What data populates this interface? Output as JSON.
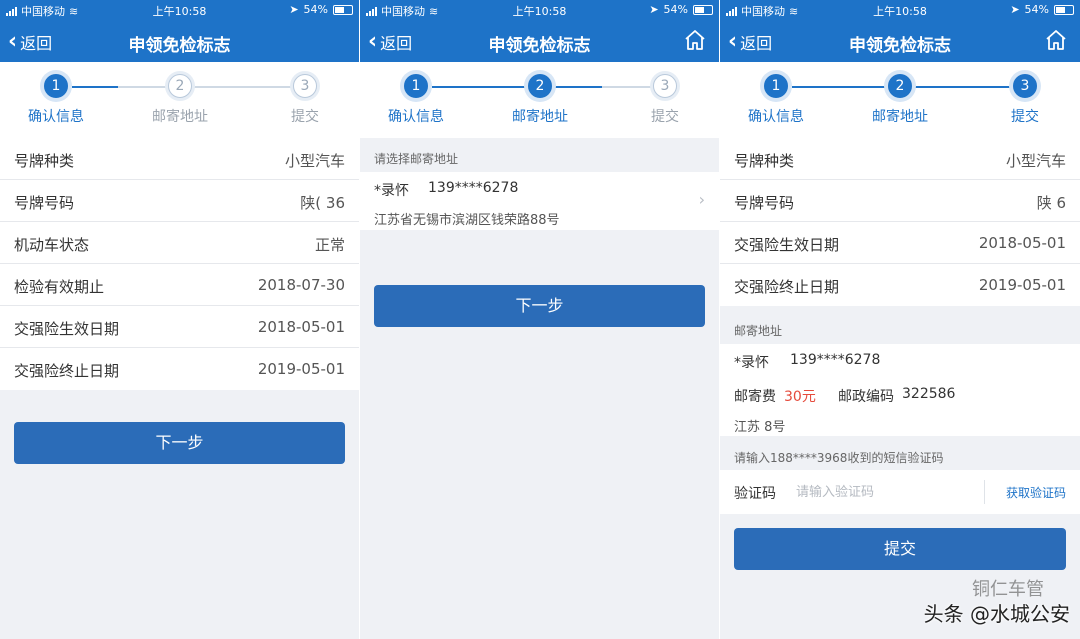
{
  "status": {
    "carrier": "中国移动",
    "time": "上午10:58",
    "battery": "54%"
  },
  "nav": {
    "back": "返回",
    "title": "申领免检标志"
  },
  "steps": [
    "确认信息",
    "邮寄地址",
    "提交"
  ],
  "screen1": {
    "rows": [
      {
        "label": "号牌种类",
        "value": "小型汽车"
      },
      {
        "label": "号牌号码",
        "value": "陕(    36"
      },
      {
        "label": "机动车状态",
        "value": "正常"
      },
      {
        "label": "检验有效期止",
        "value": "2018-07-30"
      },
      {
        "label": "交强险生效日期",
        "value": "2018-05-01"
      },
      {
        "label": "交强险终止日期",
        "value": "2019-05-01"
      }
    ],
    "next": "下一步"
  },
  "screen2": {
    "section": "请选择邮寄地址",
    "name": "*录怀",
    "phone": "139****6278",
    "address": "江苏省无锡市滨湖区钱荣路88号",
    "next": "下一步"
  },
  "screen3": {
    "rows": [
      {
        "label": "号牌种类",
        "value": "小型汽车"
      },
      {
        "label": "号牌号码",
        "value": "陕    6"
      },
      {
        "label": "交强险生效日期",
        "value": "2018-05-01"
      },
      {
        "label": "交强险终止日期",
        "value": "2019-05-01"
      }
    ],
    "mail_section": "邮寄地址",
    "name": "*录怀",
    "phone": "139****6278",
    "fee_label": "邮寄费",
    "fee": "30元",
    "postcode_label": "邮政编码",
    "postcode": "322586",
    "address": "江苏        8号",
    "sms_hint": "请输入188****3968收到的短信验证码",
    "code_label": "验证码",
    "code_placeholder": "请输入验证码",
    "get_code": "获取验证码",
    "submit": "提交"
  },
  "watermark": {
    "line1": "铜仁车管",
    "line2": "头条 @水城公安"
  },
  "colors": {
    "primary": "#1e73c8",
    "button": "#2b6cb8",
    "fee_red": "#e54b3c",
    "background": "#eff1f5"
  }
}
